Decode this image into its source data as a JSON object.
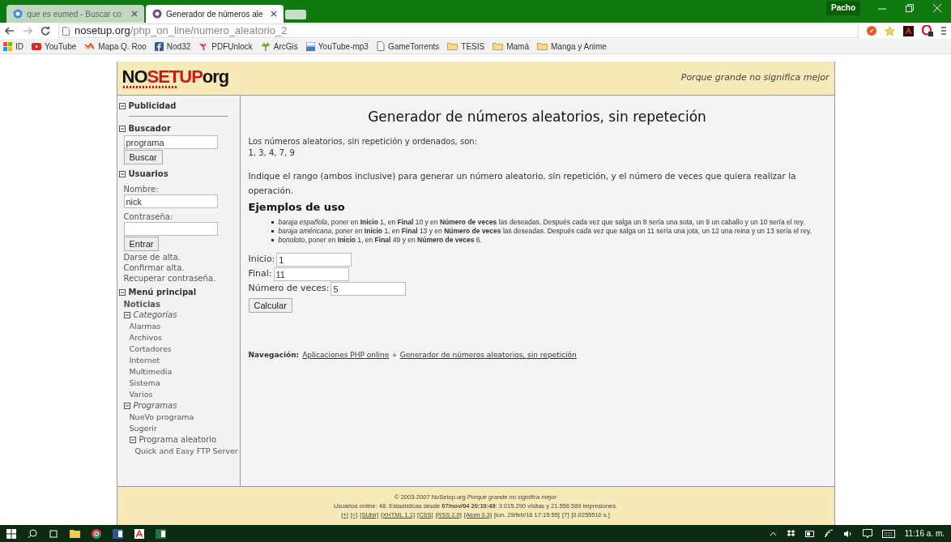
{
  "browser": {
    "tabs": [
      {
        "title": "que es eumed - Buscar co",
        "selected": false
      },
      {
        "title": "Generador de números ale",
        "selected": true
      }
    ],
    "user": "Pacho",
    "url": {
      "domain": "nosetup.org",
      "path": "/php_on_line/numero_aleatorio_2"
    },
    "bookmarks": [
      {
        "label": "ID",
        "kind": "apps"
      },
      {
        "label": "YouTube",
        "kind": "youtube"
      },
      {
        "label": "Mapa Q. Roo",
        "kind": "map"
      },
      {
        "label": "Nod32",
        "kind": "facebook"
      },
      {
        "label": "PDFUnlock",
        "kind": "pdf"
      },
      {
        "label": "ArcGis",
        "kind": "tree"
      },
      {
        "label": "YouTube-mp3",
        "kind": "yt"
      },
      {
        "label": "GameTorrents",
        "kind": "page"
      },
      {
        "label": "TESIS",
        "kind": "folder"
      },
      {
        "label": "Mamá",
        "kind": "folder"
      },
      {
        "label": "Manga y Anime",
        "kind": "folder"
      }
    ]
  },
  "header": {
    "logo": {
      "first": "NO",
      "second": "SETUP",
      "third": "org"
    },
    "quote": "Porque grande no significa mejor"
  },
  "sidebar": {
    "items": [
      {
        "kind": "heading",
        "text": "Publicidad",
        "expanded": true
      },
      {
        "kind": "divider"
      },
      {
        "kind": "heading",
        "text": "Buscador",
        "expanded": true
      },
      {
        "kind": "input",
        "value": "programa"
      },
      {
        "kind": "button",
        "text": "Buscar"
      },
      {
        "kind": "heading",
        "text": "Usuarios",
        "expanded": true
      },
      {
        "kind": "label",
        "text": "Nombre:"
      },
      {
        "kind": "input",
        "value": "nick"
      },
      {
        "kind": "label",
        "text": "Contraseña:"
      },
      {
        "kind": "input"
      },
      {
        "kind": "button",
        "text": "Entrar"
      },
      {
        "kind": "link",
        "text": "Darse de alta.",
        "bold": false
      },
      {
        "kind": "link",
        "text": "Confirmar alta.",
        "bold": false
      },
      {
        "kind": "link",
        "text": "Recuperar contraseña.",
        "bold": false
      },
      {
        "kind": "heading",
        "text": "Menú principal",
        "expanded": true
      },
      {
        "kind": "link",
        "text": "Noticias",
        "bold": true
      },
      {
        "kind": "group",
        "text": "Categorías",
        "expanded": true,
        "children": [
          {
            "text": "Alarmas"
          },
          {
            "text": "Archivos"
          },
          {
            "text": "Cortadores"
          },
          {
            "text": "Internet"
          },
          {
            "text": "Multimedia"
          },
          {
            "text": "Sistema"
          },
          {
            "text": "Varios"
          }
        ]
      },
      {
        "kind": "group",
        "text": "Programas",
        "expanded": true,
        "children": [
          {
            "text": "NueVo programa"
          },
          {
            "text": "Sugerir"
          },
          {
            "text": "Programa aleatorio",
            "expanded": true,
            "children": [
              {
                "text": "Quick and Easy FTP Server"
              }
            ]
          }
        ]
      }
    ]
  },
  "main": {
    "title": "Generador de números aleatorios, sin repeteción",
    "result_label": "Los números aleatorios, sin repetición y ordenados, son:",
    "result": "1, 3, 4, 7, 9",
    "instruction": "Indique el rango (ambos inclusive) para generar un número aleatorio, sin repetición, y el número de veces que quiera realizar la operación.",
    "examples_heading": "Ejemplos de uso",
    "examples": [
      "*baraja española*, poner en **Inicio** 1, en **Final** 10 y en **Número de veces** las deseadas. Después cada vez que salga un 8 sería una sota, un 9 un caballo y un 10 sería el rey.",
      "*baraja américana*, poner en **Inicio** 1, en **Final** 13 y en **Número de veces** las deseadas. Después cada vez que salga un 11 sería una jota, un 12 una reina y un 13 sería el rey.",
      "*bonoloto*, poner en **Inicio** 1, en **Final** 49 y en **Número de veces** 6."
    ],
    "fields": [
      {
        "label": "Inicio:",
        "value": "1"
      },
      {
        "label": "Final:",
        "value": "11"
      },
      {
        "label": "Número de veces:",
        "value": "5"
      }
    ],
    "submit": "Calcular",
    "navigation": {
      "label": "Navegación:",
      "links": [
        "Aplicaciones PHP online",
        "Generador de números aleatorios, sin repetición"
      ],
      "separator": "»"
    }
  },
  "footer": {
    "copyright": "© 2003-2007 NoSetup.org *Porque grande no significa mejor*",
    "stats": "Usuarios online: 48. Estadísticas desde **07/nov/04 20:10:49**: 3.015.290 visitas y 21.556.569 impresiones.",
    "meta": [
      {
        "text": "[+]",
        "kind": "link"
      },
      {
        "text": "[=]",
        "kind": "link"
      },
      {
        "text": "[SUbir]",
        "kind": "link"
      },
      {
        "text": "[XHTML 1.1]",
        "kind": "link"
      },
      {
        "text": "[CSS]",
        "kind": "link"
      },
      {
        "text": "[RSS 2.0]",
        "kind": "link"
      },
      {
        "text": "[Atom 0.3]",
        "kind": "link"
      },
      {
        "text": "[lun, 29/feb/16 17:15:55]",
        "kind": "text"
      },
      {
        "text": "[7]",
        "kind": "text"
      },
      {
        "text": "[0.0255510 s.]",
        "kind": "text"
      }
    ]
  },
  "taskbar": {
    "time": "11:16 a. m."
  }
}
